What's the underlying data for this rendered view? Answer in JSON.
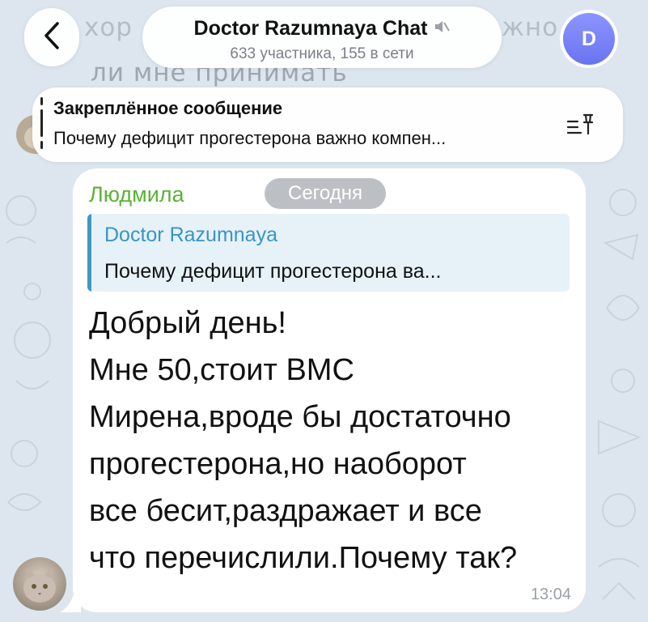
{
  "background": {
    "faded_text_top": [
      "хор",
      "жно"
    ],
    "faded_text_line2": "ли мне принимать"
  },
  "header": {
    "back_icon": "chevron-left-icon",
    "title": "Doctor Razumnaya Chat",
    "muted_icon": "muted-speaker-icon",
    "subtitle": "633 участника, 155 в сети",
    "avatar_letter": "D"
  },
  "pinned": {
    "title": "Закреплённое сообщение",
    "text": "Почему дефицит прогестерона важно компен...",
    "icon": "pinned-list-icon"
  },
  "message": {
    "sender": "Людмила",
    "date_pill": "Сегодня",
    "reply_author": "Doctor Razumnaya",
    "reply_text": "Почему дефицит прогестерона ва...",
    "lines": [
      "Добрый день!",
      "Мне 50,стоит ВМС",
      "Мирена,вроде бы достаточно",
      "прогестерона,но наоборот",
      "все бесит,раздражает и все",
      "что перечислили.Почему так?"
    ],
    "time": "13:04"
  },
  "colors": {
    "background": "#dde6ee",
    "sender_name": "#5bb238",
    "reply_accent": "#3a94c3",
    "avatar_gradient": [
      "#8b96ff",
      "#6a73f0"
    ]
  }
}
